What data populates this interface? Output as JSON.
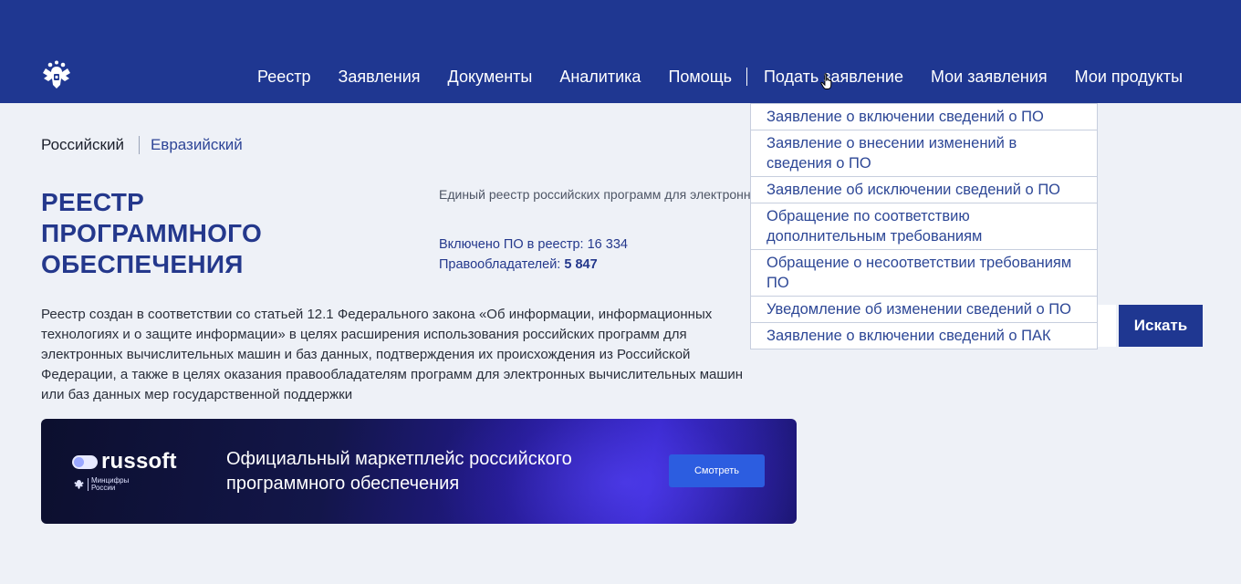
{
  "header": {
    "nav": [
      "Реестр",
      "Заявления",
      "Документы",
      "Аналитика",
      "Помощь"
    ],
    "nav_right": [
      "Подать заявление",
      "Мои заявления",
      "Мои продукты"
    ]
  },
  "tabs": {
    "active": "Российский",
    "other": "Евразийский"
  },
  "title": "Реестр программного обеспечения",
  "intro": "Единый реестр российских программ для электронных вычислительных машин и баз данных",
  "stats": {
    "included_label": "Включено ПО в реестр:",
    "included_value": "16 334",
    "holders_label": "Правообладателей:",
    "holders_value": "5 847"
  },
  "description": "Реестр создан в соответствии со статьей 12.1 Федерального закона «Об информации, информационных технологиях и о защите информации» в целях расширения использования российских программ для электронных вычислительных машин и баз данных, подтверждения их происхождения из Российской Федерации, а также в целях оказания правообладателям программ для электронных вычислительных машин или баз данных мер государственной поддержки",
  "search": {
    "button_label": "Искать",
    "value": "",
    "placeholder": ""
  },
  "banner": {
    "brand": "russoft",
    "ministry": "Минцифры России",
    "text": "Официальный маркетплейс российского программного обеспечения",
    "button_label": "Смотреть"
  },
  "dropdown": {
    "items": [
      "Заявление о включении сведений о ПО",
      "Заявление о внесении изменений в сведения о ПО",
      "Заявление об исключении сведений о ПО",
      "Обращение по соответствию дополнительным требованиям",
      "Обращение о несоответствии требованиям ПО",
      "Уведомление об изменении сведений о ПО",
      "Заявление о включении сведений о ПАК"
    ]
  },
  "colors": {
    "header_bg": "#1f3791",
    "accent": "#24388c",
    "link": "#2d4796",
    "banner_button": "#2c5de0"
  }
}
